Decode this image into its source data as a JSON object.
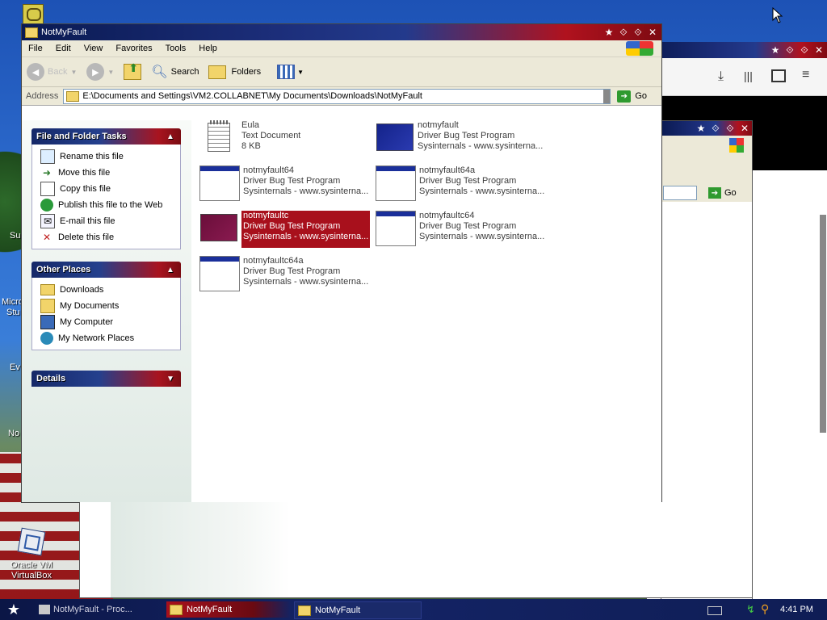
{
  "desktop": {
    "icons": [
      {
        "label": "Oracle VM VirtualBox"
      }
    ],
    "fragments": {
      "micro": "Micro",
      "stu": "Stu",
      "su": "Su",
      "ev": "Ev",
      "no": "No"
    }
  },
  "explorer": {
    "title": "NotMyFault",
    "menu": [
      "File",
      "Edit",
      "View",
      "Favorites",
      "Tools",
      "Help"
    ],
    "toolbar": {
      "back": "Back",
      "search": "Search",
      "folders": "Folders"
    },
    "address": {
      "label": "Address",
      "value": "E:\\Documents and Settings\\VM2.COLLABNET\\My Documents\\Downloads\\NotMyFault",
      "go": "Go"
    },
    "tasks": {
      "title": "File and Folder Tasks",
      "items": [
        "Rename this file",
        "Move this file",
        "Copy this file",
        "Publish this file to the Web",
        "E-mail this file",
        "Delete this file"
      ]
    },
    "places": {
      "title": "Other Places",
      "items": [
        "Downloads",
        "My Documents",
        "My Computer",
        "My Network Places"
      ]
    },
    "details": {
      "title": "Details"
    },
    "files": [
      {
        "name": "Eula",
        "line2": "Text Document",
        "line3": "8 KB"
      },
      {
        "name": "notmyfault",
        "line2": "Driver Bug Test Program",
        "line3": "Sysinternals - www.sysinterna..."
      },
      {
        "name": "notmyfault64",
        "line2": "Driver Bug Test Program",
        "line3": "Sysinternals - www.sysinterna..."
      },
      {
        "name": "notmyfault64a",
        "line2": "Driver Bug Test Program",
        "line3": "Sysinternals - www.sysinterna..."
      },
      {
        "name": "notmyfaultc",
        "line2": "Driver Bug Test Program",
        "line3": "Sysinternals - www.sysinterna..."
      },
      {
        "name": "notmyfaultc64",
        "line2": "Driver Bug Test Program",
        "line3": "Sysinternals - www.sysinterna..."
      },
      {
        "name": "notmyfaultc64a",
        "line2": "Driver Bug Test Program",
        "line3": "Sysinternals - www.sysinterna..."
      }
    ]
  },
  "back_window": {
    "go": "Go"
  },
  "taskbar": {
    "items": [
      "NotMyFault - Proc...",
      "NotMyFault",
      "NotMyFault"
    ],
    "time": "4:41 PM"
  },
  "colors": {
    "selection": "#a8101c",
    "title_blue": "#0a1a52",
    "title_red": "#b0121e"
  }
}
